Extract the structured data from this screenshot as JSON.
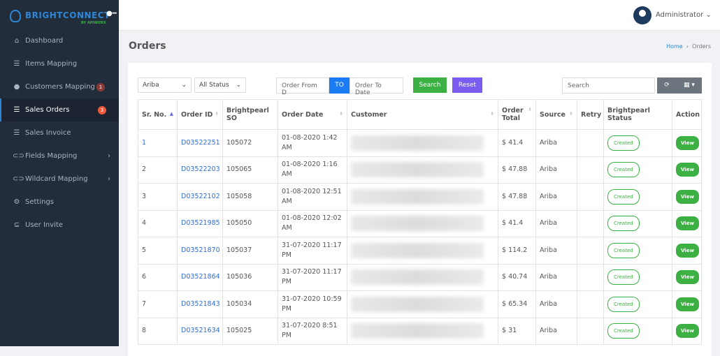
{
  "brand": {
    "name": "BRIGHTCONNECT",
    "sub": "BY APIWORX"
  },
  "sidebar": {
    "items": [
      {
        "label": "Dashboard",
        "icon": "home-icon"
      },
      {
        "label": "Items Mapping",
        "icon": "list-icon"
      },
      {
        "label": "Customers Mapping",
        "icon": "user-icon",
        "badge": "1"
      },
      {
        "label": "Sales Orders",
        "icon": "list-icon",
        "badge": "3",
        "active": true
      },
      {
        "label": "Sales Invoice",
        "icon": "list-icon"
      },
      {
        "label": "Fields Mapping",
        "icon": "link-icon",
        "chevron": true
      },
      {
        "label": "Wildcard Mapping",
        "icon": "link-icon",
        "chevron": true
      },
      {
        "label": "Settings",
        "icon": "gear-icon"
      },
      {
        "label": "User Invite",
        "icon": "invite-icon"
      }
    ]
  },
  "header": {
    "user": "Administrator"
  },
  "page": {
    "title": "Orders",
    "breadcrumb": [
      "Home",
      "Orders"
    ]
  },
  "filters": {
    "source": "Ariba",
    "status": "All Status",
    "from_placeholder": "Order From D",
    "to_label": "TO",
    "to_placeholder": "Order To Date",
    "search_btn": "Search",
    "reset_btn": "Reset",
    "search_placeholder": "Search"
  },
  "colors": {
    "sidebar": "#222d3c",
    "green": "#3cb043",
    "purple": "#7b5cf0",
    "blue": "#1a7cf5",
    "badge_red": "#f05a3c"
  },
  "table": {
    "headers": [
      "Sr. No.",
      "Order ID",
      "Brightpearl SO",
      "Order Date",
      "Customer",
      "Order Total",
      "Source",
      "Retry",
      "Brightpearl Status",
      "Action"
    ],
    "rows": [
      {
        "sr": "1",
        "id": "D03522251",
        "so": "105072",
        "date": "01-08-2020 1:42 AM",
        "total": "$ 41.4",
        "source": "Ariba",
        "status": "Created",
        "action": "View"
      },
      {
        "sr": "2",
        "id": "D03522203",
        "so": "105065",
        "date": "01-08-2020 1:16 AM",
        "total": "$ 47.88",
        "source": "Ariba",
        "status": "Created",
        "action": "View"
      },
      {
        "sr": "3",
        "id": "D03522102",
        "so": "105058",
        "date": "01-08-2020 12:51 AM",
        "total": "$ 47.88",
        "source": "Ariba",
        "status": "Created",
        "action": "View"
      },
      {
        "sr": "4",
        "id": "D03521985",
        "so": "105050",
        "date": "01-08-2020 12:02 AM",
        "total": "$ 41.4",
        "source": "Ariba",
        "status": "Created",
        "action": "View"
      },
      {
        "sr": "5",
        "id": "D03521870",
        "so": "105037",
        "date": "31-07-2020 11:17 PM",
        "total": "$ 114.2",
        "source": "Ariba",
        "status": "Created",
        "action": "View"
      },
      {
        "sr": "6",
        "id": "D03521864",
        "so": "105036",
        "date": "31-07-2020 11:17 PM",
        "total": "$ 40.74",
        "source": "Ariba",
        "status": "Created",
        "action": "View"
      },
      {
        "sr": "7",
        "id": "D03521843",
        "so": "105034",
        "date": "31-07-2020 10:59 PM",
        "total": "$ 65.34",
        "source": "Ariba",
        "status": "Created",
        "action": "View"
      },
      {
        "sr": "8",
        "id": "D03521634",
        "so": "105025",
        "date": "31-07-2020 8:51 PM",
        "total": "$ 31",
        "source": "Ariba",
        "status": "Created",
        "action": "View"
      }
    ]
  }
}
